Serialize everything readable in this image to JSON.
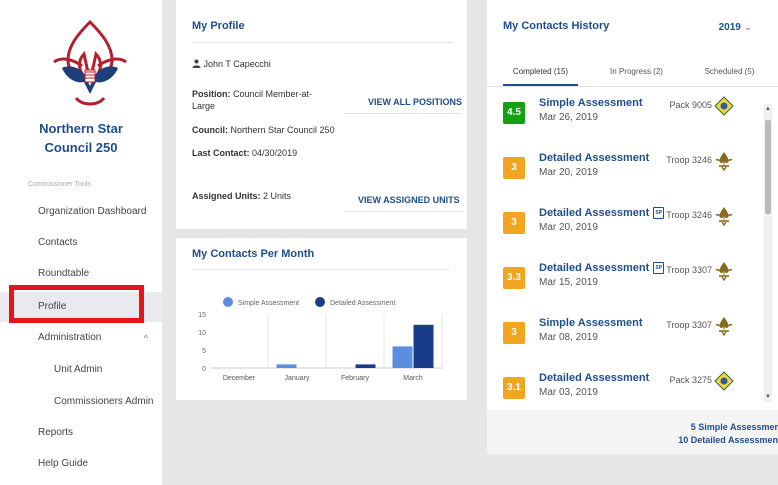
{
  "sidebar": {
    "council_name": "Northern Star Council 250",
    "section_label": "Commissioner Tools",
    "items": [
      {
        "label": "Organization Dashboard"
      },
      {
        "label": "Contacts"
      },
      {
        "label": "Roundtable"
      },
      {
        "label": "Profile"
      },
      {
        "label": "Administration"
      },
      {
        "label": "Unit Admin"
      },
      {
        "label": "Commissioners Admin"
      },
      {
        "label": "Reports"
      },
      {
        "label": "Help Guide"
      }
    ]
  },
  "profile": {
    "title": "My Profile",
    "name": "John T Capecchi",
    "position_label": "Position:",
    "position_value": "Council Member-at-Large",
    "council_label": "Council:",
    "council_value": "Northern Star Council 250",
    "last_contact_label": "Last Contact:",
    "last_contact_value": "04/30/2019",
    "assigned_units_label": "Assigned Units:",
    "assigned_units_value": "2 Units",
    "view_positions": "VIEW ALL POSITIONS",
    "view_units": "VIEW ASSIGNED UNITS"
  },
  "contacts_chart_title": "My Contacts Per Month",
  "chart_data": {
    "type": "bar",
    "categories": [
      "December",
      "January",
      "February",
      "March"
    ],
    "series": [
      {
        "name": "Simple Assessment",
        "values": [
          0,
          1,
          0,
          6
        ],
        "color": "#5b8fde"
      },
      {
        "name": "Detailed Assessment",
        "values": [
          0,
          0,
          1,
          12
        ],
        "color": "#1a3a8a"
      }
    ],
    "yticks": [
      "15",
      "10",
      "5",
      "0"
    ],
    "ylim": [
      0,
      15
    ],
    "legend": "top"
  },
  "history": {
    "title": "My Contacts History",
    "year": "2019",
    "tabs": [
      "Completed (15)",
      "In Progress (2)",
      "Scheduled (5)"
    ],
    "rows": [
      {
        "score": "4.5",
        "score_color": "#12a112",
        "title": "Simple Assessment",
        "date": "Mar 26, 2019",
        "unit": "Pack 9005",
        "badge": "cub",
        "sp": false
      },
      {
        "score": "3",
        "score_color": "#f2a521",
        "title": "Detailed Assessment",
        "date": "Mar 20, 2019",
        "unit": "Troop 3246",
        "badge": "fleur",
        "sp": false
      },
      {
        "score": "3",
        "score_color": "#f2a521",
        "title": "Detailed Assessment",
        "date": "Mar 20, 2019",
        "unit": "Troop 3246",
        "badge": "fleur",
        "sp": true
      },
      {
        "score": "3.3",
        "score_color": "#f2a521",
        "title": "Detailed Assessment",
        "date": "Mar 15, 2019",
        "unit": "Troop 3307",
        "badge": "fleur",
        "sp": true
      },
      {
        "score": "3",
        "score_color": "#f2a521",
        "title": "Simple Assessment",
        "date": "Mar 08, 2019",
        "unit": "Troop 3307",
        "badge": "fleur",
        "sp": false
      },
      {
        "score": "3.1",
        "score_color": "#f2a521",
        "title": "Detailed Assessment",
        "date": "Mar 03, 2019",
        "unit": "Pack 3275",
        "badge": "cub",
        "sp": false
      }
    ],
    "sp_label": "SP",
    "footer_simple": "5 Simple Assessmer",
    "footer_detailed": "10 Detailed Assessmen"
  }
}
